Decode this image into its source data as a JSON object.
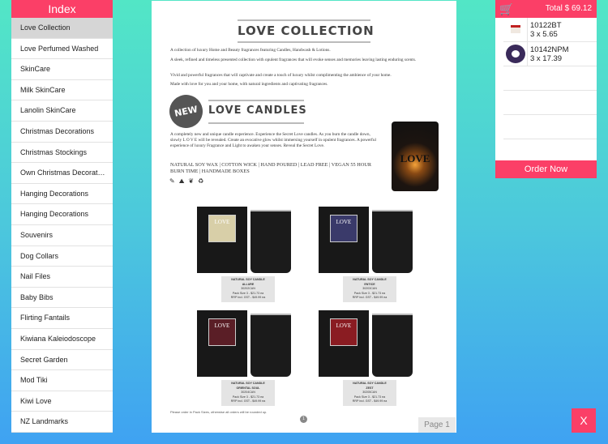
{
  "sidebar": {
    "title": "Index",
    "items": [
      "Love Collection",
      "Love Perfumed Washed",
      "SkinCare",
      "Milk SkinCare",
      "Lanolin SkinCare",
      "Christmas Decorations",
      "Christmas Stockings",
      "Own Christmas Decorations",
      "Hanging Decorations",
      "Hanging Decorations",
      "Souvenirs",
      "Dog Collars",
      "Nail Files",
      "Baby Bibs",
      "Flirting Fantails",
      "Kiwiana Kaleiodoscope",
      "Secret Garden",
      "Mod Tiki",
      "Kiwi Love",
      "NZ Landmarks"
    ],
    "selected": 0
  },
  "doc": {
    "title": "LOVE COLLECTION",
    "paras": [
      "A collection of luxury Home and Beauty fragrances featuring Candles, Handwash & Lotions.",
      "A sleek, refined and timeless presented collection with opulent fragrances that will evoke senses and memories leaving lasting enduring scents.",
      "Vivid and powerful fragrances that will captivate and create a touch of luxury whilst complimenting the ambience of your home.",
      "Made with love for you and your home, with natural ingredients and captivating fragrances."
    ],
    "badge": "NEW",
    "subtitle": "LOVE CANDLES",
    "candle_text": "A completely new and unique candle experience. Experience the Secret Love candles. As you burn the candle down, slowly L O V E will be revealed. Create an evocative glow whilst immersing yourself in opulent fragrances. A powerful experience of luxury Fragrance and Light to awaken your senses. Reveal the Secret Love.",
    "features": "NATURAL SOY WAX | COTTON WICK | HAND POURED | LEAD FREE | VEGAN 55 HOUR BURN TIME | HANDMADE BOXES",
    "candle_word": "LOVE",
    "products": [
      {
        "name": "NATURAL SOY CANDLE",
        "variant": "ALLURE",
        "code": "30202CAN",
        "pack": "Pack Size 3 - $21.73 ea",
        "rrp": "RRP incl. GST - $49.99 ea",
        "label": "LOVE",
        "color": "#d8cfa8"
      },
      {
        "name": "NATURAL SOY CANDLE",
        "variant": "ENTICE",
        "code": "30203CAN",
        "pack": "Pack Size 3 - $21.73 ea",
        "rrp": "RRP incl. GST - $49.99 ea",
        "label": "LOVE",
        "color": "#3a3a6a"
      },
      {
        "name": "NATURAL SOY CANDLE",
        "variant": "ORIENTAL SOUL",
        "code": "30204CAN",
        "pack": "Pack Size 3 - $21.73 ea",
        "rrp": "RRP incl. GST - $49.99 ea",
        "label": "LOVE",
        "color": "#5a1e26"
      },
      {
        "name": "NATURAL SOY CANDLE",
        "variant": "ZEST",
        "code": "30205CAN",
        "pack": "Pack Size 3 - $21.73 ea",
        "rrp": "RRP incl. GST - $49.99 ea",
        "label": "LOVE",
        "color": "#8a1c22"
      }
    ],
    "note": "Please order in Pack Sizes, otherwise all orders will be rounded up.",
    "page_dot": "1",
    "page_label": "Page 1"
  },
  "cart": {
    "total": "Total $ 69.12",
    "items": [
      {
        "code": "10122BT",
        "qty": "3 x 5.65"
      },
      {
        "code": "10142NPM",
        "qty": "3 x 17.39"
      }
    ],
    "order": "Order Now"
  },
  "close": "X",
  "colors": {
    "accent": "#fb3f67"
  }
}
